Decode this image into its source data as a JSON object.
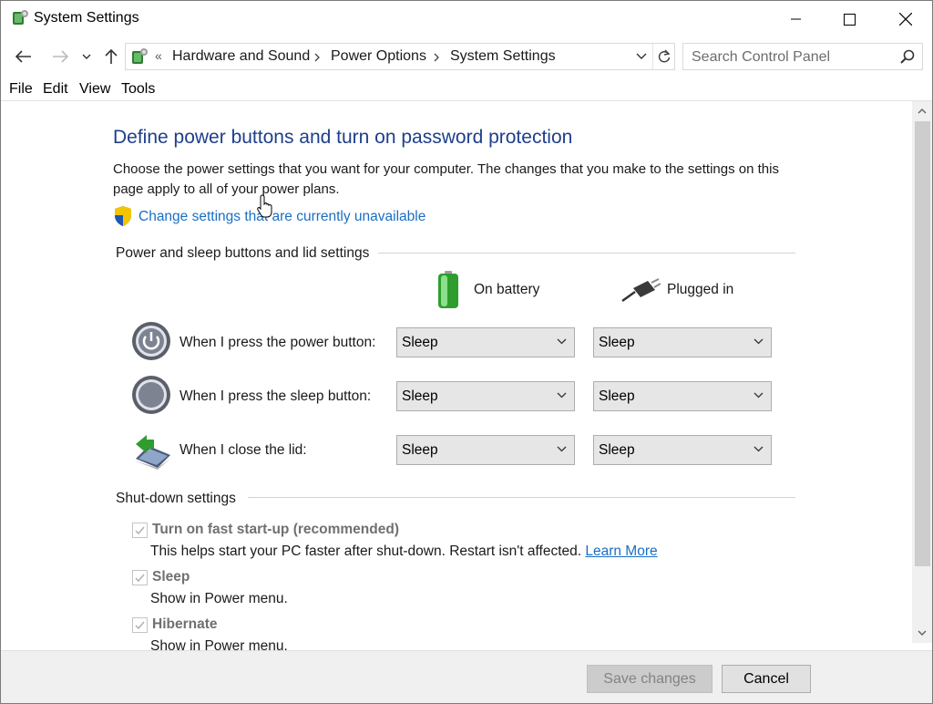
{
  "window": {
    "title": "System Settings"
  },
  "nav": {
    "breadcrumbs": [
      "Hardware and Sound",
      "Power Options",
      "System Settings"
    ],
    "overflow": "«",
    "search_placeholder": "Search Control Panel"
  },
  "menu": {
    "items": [
      "File",
      "Edit",
      "View",
      "Tools"
    ]
  },
  "main": {
    "heading": "Define power buttons and turn on password protection",
    "description": "Choose the power settings that you want for your computer. The changes that you make to the settings on this page apply to all of your power plans.",
    "change_link": "Change settings that are currently unavailable",
    "power_section": {
      "label": "Power and sleep buttons and lid settings",
      "col_battery": "On battery",
      "col_plugged": "Plugged in",
      "rows": [
        {
          "label": "When I press the power button:",
          "battery": "Sleep",
          "plugged": "Sleep",
          "icon": "power-button-icon"
        },
        {
          "label": "When I press the sleep button:",
          "battery": "Sleep",
          "plugged": "Sleep",
          "icon": "sleep-button-icon"
        },
        {
          "label": "When I close the lid:",
          "battery": "Sleep",
          "plugged": "Sleep",
          "icon": "laptop-lid-icon"
        }
      ]
    },
    "shutdown_section": {
      "label": "Shut-down settings",
      "items": [
        {
          "label": "Turn on fast start-up (recommended)",
          "desc": "This helps start your PC faster after shut-down. Restart isn't affected.",
          "link": "Learn More",
          "checked": true
        },
        {
          "label": "Sleep",
          "desc": "Show in Power menu.",
          "checked": true
        },
        {
          "label": "Hibernate",
          "desc": "Show in Power menu.",
          "checked": true
        }
      ]
    }
  },
  "footer": {
    "save_label": "Save changes",
    "cancel_label": "Cancel"
  },
  "colors": {
    "heading": "#1e3f8a",
    "link": "#1a6fc4",
    "disabled_text": "#707070"
  }
}
